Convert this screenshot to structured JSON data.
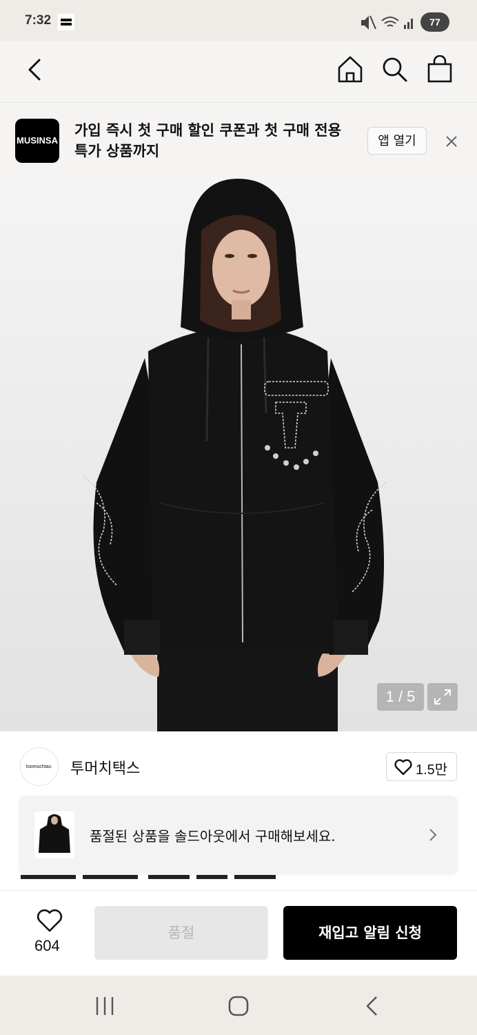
{
  "status_bar": {
    "time": "7:32",
    "battery": "77"
  },
  "banner": {
    "logo_text": "MUSINSA",
    "message": "가입 즉시 첫 구매 할인 쿠폰과 첫 구매 전용 특가 상품까지",
    "open_app_label": "앱 열기"
  },
  "gallery": {
    "counter": "1 / 5"
  },
  "brand": {
    "logo_text": "toomuchtax.",
    "name": "투머치택스",
    "like_count": "1.5만"
  },
  "notice": {
    "text": "품절된 상품을 솔드아웃에서 구매해보세요."
  },
  "actions": {
    "favorite_count": "604",
    "soldout_label": "품절",
    "restock_label": "재입고 알림 신청"
  },
  "icons": [
    "back-icon",
    "home-icon",
    "search-icon",
    "shopping-bag-icon",
    "close-icon",
    "expand-icon",
    "heart-icon",
    "chevron-right-icon",
    "nav-recents-icon",
    "nav-home-icon",
    "nav-back-icon"
  ]
}
